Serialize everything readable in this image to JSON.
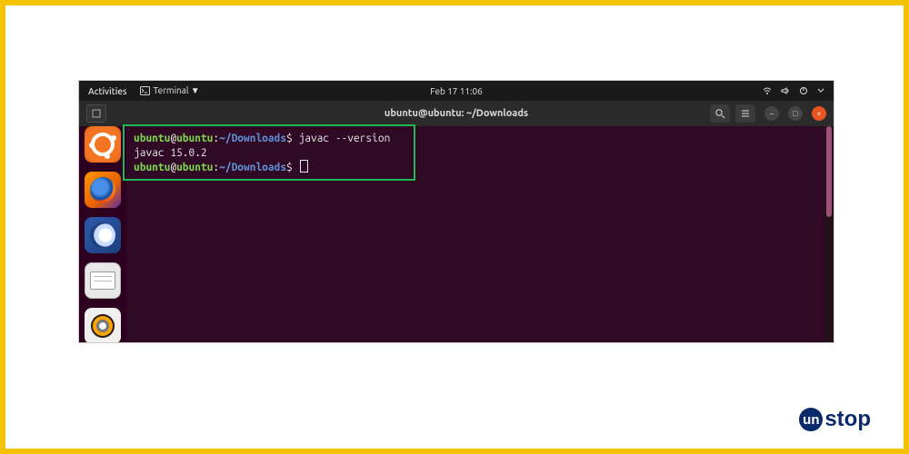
{
  "gnome": {
    "activities": "Activities",
    "app_menu": "Terminal ▼",
    "clock": "Feb 17  11:06"
  },
  "terminal_window": {
    "title": "ubuntu@ubuntu: ~/Downloads",
    "newtab_label": "+",
    "search_icon_label": "search",
    "menu_icon_label": "menu",
    "min_label": "–",
    "max_label": "□",
    "close_label": "×"
  },
  "prompt": {
    "user": "ubuntu",
    "at": "@",
    "host": "ubuntu",
    "colon": ":",
    "path": "~/Downloads",
    "dollar": "$"
  },
  "terminal_output": {
    "line1_cmd": " javac --version",
    "line2": "javac 15.0.2",
    "line3_cmd": " "
  },
  "brand": {
    "u": "un",
    "rest": "stop"
  }
}
